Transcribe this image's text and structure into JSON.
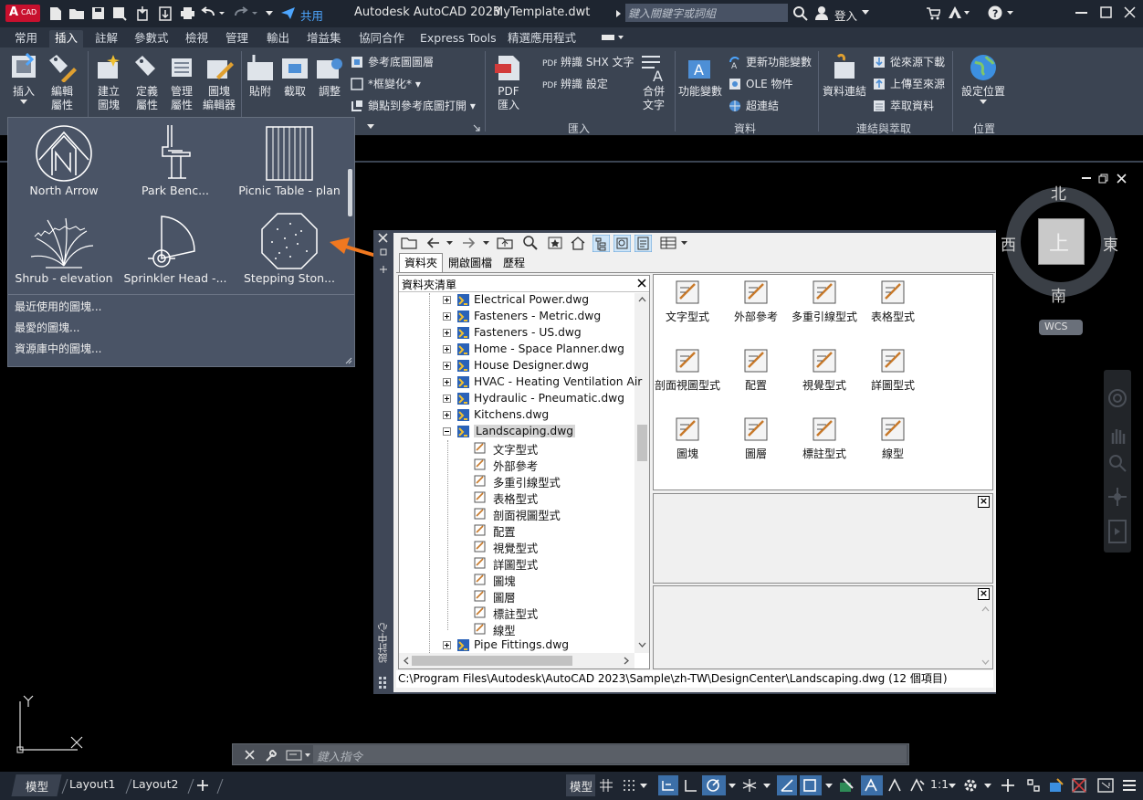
{
  "app": {
    "logo_letter": "A",
    "logo_text": "CAD",
    "share": "共用",
    "title": "Autodesk AutoCAD 2023",
    "document": "MyTemplate.dwt",
    "search_placeholder": "鍵入關鍵字或詞組",
    "signin": "登入"
  },
  "tabs": [
    "常用",
    "插入",
    "註解",
    "參數式",
    "檢視",
    "管理",
    "輸出",
    "增益集",
    "協同合作",
    "Express Tools",
    "精選應用程式"
  ],
  "ribbon": {
    "insert": "插入",
    "edit_attr": [
      "編輯",
      "屬性"
    ],
    "create_block": [
      "建立",
      "圖塊"
    ],
    "define_attr": [
      "定義",
      "屬性"
    ],
    "manage_attr": [
      "管理",
      "屬性"
    ],
    "block_editor": [
      "圖塊",
      "編輯器"
    ],
    "attach": "貼附",
    "clip": "截取",
    "adjust": "調整",
    "underlay_layers": "參考底圖圖層",
    "frames_vary": "*框變化*",
    "snap_underlays": "鎖點到參考底圖打開",
    "pdf_import": [
      "PDF",
      "匯入"
    ],
    "recognize_shx": "辨識 SHX 文字",
    "recognize_settings": "辨識 設定",
    "combine_text": [
      "合併",
      "文字"
    ],
    "field": "功能變數",
    "update_fields": "更新功能變數",
    "ole_object": "OLE 物件",
    "hyperlink": "超連結",
    "data_link": "資料連結",
    "download_source": "從來源下載",
    "upload_source": "上傳至來源",
    "extract_data": "萃取資料",
    "set_location": "設定位置",
    "panel_import": "匯入",
    "panel_data": "資料",
    "panel_link": "連結與萃取",
    "panel_location": "位置"
  },
  "gallery": {
    "items": [
      "North Arrow",
      "Park Benc...",
      "Picnic Table - plan",
      "Shrub - elevation",
      "Sprinkler Head -...",
      "Stepping Ston..."
    ],
    "links": [
      "最近使用的圖塊...",
      "最愛的圖塊...",
      "資源庫中的圖塊..."
    ]
  },
  "designcenter": {
    "tabs": [
      "資料夾",
      "開啟圖檔",
      "歷程"
    ],
    "tree_header": "資料夾清單",
    "side_title": "設計中心",
    "files": [
      "Electrical Power.dwg",
      "Fasteners - Metric.dwg",
      "Fasteners - US.dwg",
      "Home - Space Planner.dwg",
      "House Designer.dwg",
      "HVAC - Heating Ventilation Air",
      "Hydraulic - Pneumatic.dwg",
      "Kitchens.dwg",
      "Landscaping.dwg"
    ],
    "children": [
      "文字型式",
      "外部參考",
      "多重引線型式",
      "表格型式",
      "剖面視圖型式",
      "配置",
      "視覺型式",
      "詳圖型式",
      "圖塊",
      "圖層",
      "標註型式",
      "線型"
    ],
    "last_file": "Pipe Fittings.dwg",
    "content_items": [
      "文字型式",
      "外部參考",
      "多重引線型式",
      "表格型式",
      "剖面視圖型式",
      "配置",
      "視覺型式",
      "詳圖型式",
      "圖塊",
      "圖層",
      "標註型式",
      "線型"
    ],
    "path": "C:\\Program Files\\Autodesk\\AutoCAD 2023\\Sample\\zh-TW\\DesignCenter\\Landscaping.dwg (12 個項目)"
  },
  "viewcube": {
    "north": "北",
    "south": "南",
    "east": "東",
    "west": "西",
    "face": "上",
    "wcs": "WCS"
  },
  "command": {
    "placeholder": "鍵入指令"
  },
  "status": {
    "model_tab": "模型",
    "layouts": [
      "Layout1",
      "Layout2"
    ],
    "model": "模型",
    "scale": "1:1"
  },
  "ucs": {
    "x": "X",
    "y": "Y"
  }
}
